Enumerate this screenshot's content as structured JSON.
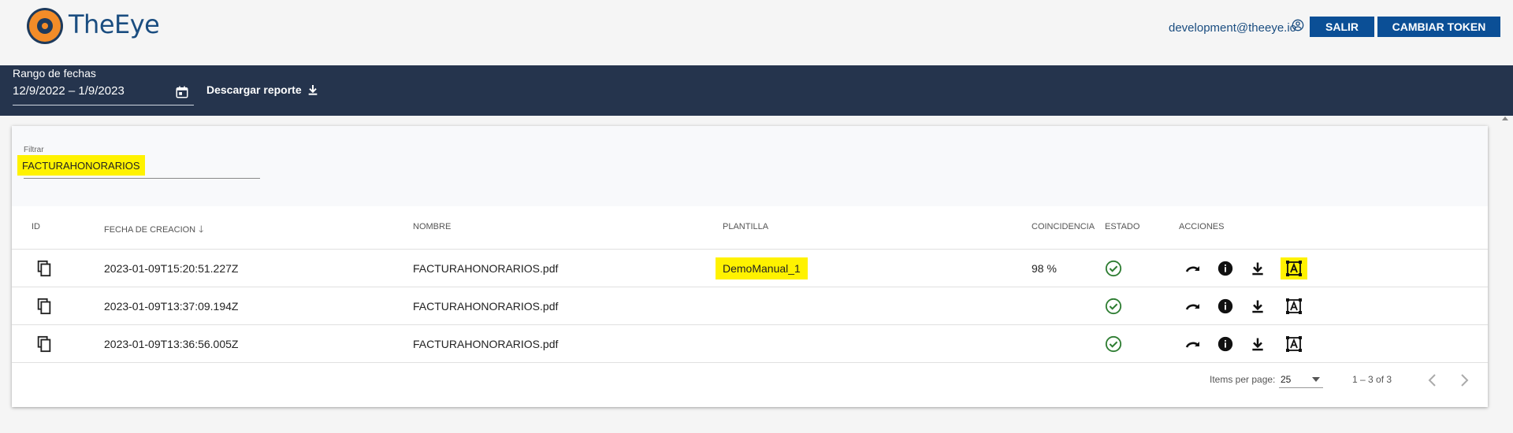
{
  "header": {
    "brand": "TheEye",
    "user_email": "development@theeye.io",
    "salir_label": "SALIR",
    "token_label": "CAMBIAR TOKEN"
  },
  "toolbar": {
    "range_label": "Rango de fechas",
    "range_value": "12/9/2022 – 1/9/2023",
    "download_label": "Descargar reporte"
  },
  "filter": {
    "label": "Filtrar",
    "value": "FACTURAHONORARIOS"
  },
  "table": {
    "columns": {
      "id": "ID",
      "date": "FECHA DE CREACION",
      "name": "NOMBRE",
      "template": "PLANTILLA",
      "match": "COINCIDENCIA",
      "state": "ESTADO",
      "actions": "ACCIONES"
    },
    "rows": [
      {
        "date": "2023-01-09T15:20:51.227Z",
        "name": "FACTURAHONORARIOS.pdf",
        "template": "DemoManual_1",
        "match": "98 %",
        "state": "check-circle-icon"
      },
      {
        "date": "2023-01-09T13:37:09.194Z",
        "name": "FACTURAHONORARIOS.pdf",
        "template": "",
        "match": "",
        "state": "check-circle-icon"
      },
      {
        "date": "2023-01-09T13:36:56.005Z",
        "name": "FACTURAHONORARIOS.pdf",
        "template": "",
        "match": "",
        "state": "check-circle-icon"
      }
    ]
  },
  "paginator": {
    "items_per_page_label": "Items per page:",
    "items_per_page": "25",
    "range": "1 – 3 of 3"
  },
  "colors": {
    "accent": "#0b4f96",
    "toolbar": "#25344d",
    "highlight": "#fff200",
    "success": "#2e7d32"
  }
}
